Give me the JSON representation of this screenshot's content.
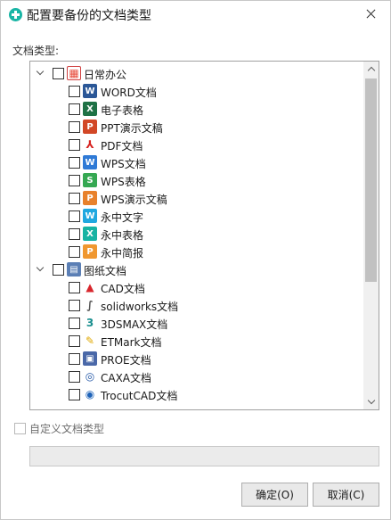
{
  "window": {
    "title": "配置要备份的文档类型",
    "accent": "#19b5a5"
  },
  "section_label": "文档类型:",
  "tree": {
    "groups": [
      {
        "label": "日常办公",
        "icon": "office-folder-icon",
        "expanded": true,
        "checked": false,
        "items": [
          {
            "label": "WORD文档",
            "icon": "word-icon",
            "checked": false
          },
          {
            "label": "电子表格",
            "icon": "excel-icon",
            "checked": false
          },
          {
            "label": "PPT演示文稿",
            "icon": "ppt-icon",
            "checked": false
          },
          {
            "label": "PDF文档",
            "icon": "pdf-icon",
            "checked": false
          },
          {
            "label": "WPS文档",
            "icon": "wps-writer-icon",
            "checked": false
          },
          {
            "label": "WPS表格",
            "icon": "wps-sheet-icon",
            "checked": false
          },
          {
            "label": "WPS演示文稿",
            "icon": "wps-presentation-icon",
            "checked": false
          },
          {
            "label": "永中文字",
            "icon": "yozo-writer-icon",
            "checked": false
          },
          {
            "label": "永中表格",
            "icon": "yozo-sheet-icon",
            "checked": false
          },
          {
            "label": "永中简报",
            "icon": "yozo-presentation-icon",
            "checked": false
          }
        ]
      },
      {
        "label": "图纸文档",
        "icon": "drawing-folder-icon",
        "expanded": true,
        "checked": false,
        "items": [
          {
            "label": "CAD文档",
            "icon": "autocad-icon",
            "checked": false
          },
          {
            "label": "solidworks文档",
            "icon": "solidworks-icon",
            "checked": false
          },
          {
            "label": "3DSMAX文档",
            "icon": "3dsmax-icon",
            "checked": false
          },
          {
            "label": "ETMark文档",
            "icon": "etmark-icon",
            "checked": false
          },
          {
            "label": "PROE文档",
            "icon": "proe-icon",
            "checked": false
          },
          {
            "label": "CAXA文档",
            "icon": "caxa-icon",
            "checked": false
          },
          {
            "label": "TrocutCAD文档",
            "icon": "trocutcad-icon",
            "checked": false
          }
        ]
      }
    ]
  },
  "custom": {
    "label": "自定义文档类型",
    "checked": false,
    "value": ""
  },
  "buttons": {
    "ok": "确定(O)",
    "cancel": "取消(C)"
  }
}
